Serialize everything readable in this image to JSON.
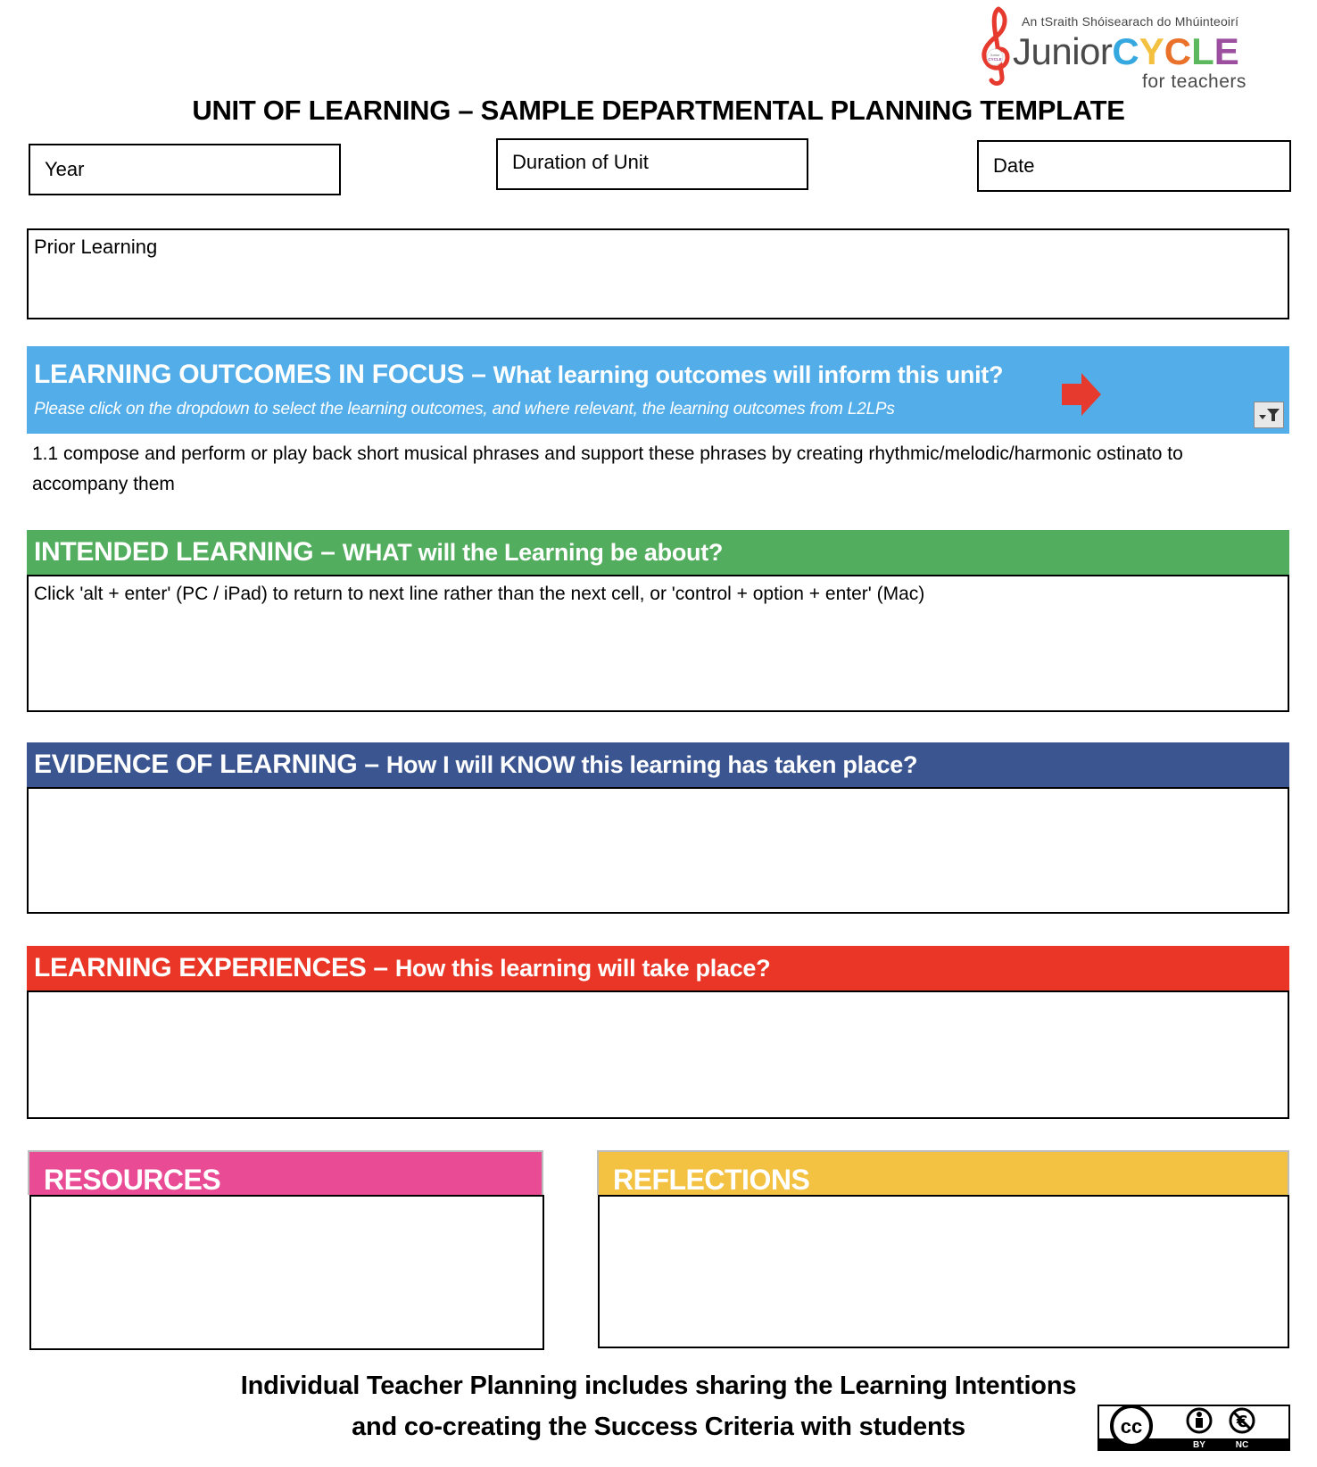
{
  "logo": {
    "tagline": "An tSraith Shóisearach do Mhúinteoirí",
    "junior": "Junior",
    "cycle_letters": [
      "C",
      "Y",
      "C",
      "L",
      "E"
    ],
    "cycle_colors": [
      "#35a8e0",
      "#f3c03f",
      "#e9712a",
      "#5cb85c",
      "#9b4f9e"
    ],
    "for_teachers": "for teachers",
    "clef_color": "#e63a2e"
  },
  "title": "UNIT OF LEARNING – SAMPLE DEPARTMENTAL PLANNING TEMPLATE",
  "fields": {
    "year_label": "Year",
    "duration_label": "Duration of Unit",
    "date_label": "Date"
  },
  "prior_learning": {
    "label": "Prior Learning"
  },
  "learning_outcomes": {
    "heading_main": "LEARNING OUTCOMES IN FOCUS – ",
    "heading_sub": "What learning outcomes will inform this unit?",
    "hint": "Please  click on the dropdown to select the learning outcomes, and where relevant, the learning outcomes from L2LPs",
    "selected_outcome": "1.1 compose and perform or play back short musical phrases and support these phrases by creating rhythmic/melodic/harmonic ostinato to accompany them",
    "color": "#52ade8",
    "arrow_color": "#e63a2e"
  },
  "intended_learning": {
    "heading_main": "INTENDED LEARNING – ",
    "heading_sub": "WHAT will the Learning be about?",
    "body": "Click 'alt + enter' (PC / iPad) to return to next line rather than the next cell, or 'control + option + enter' (Mac)",
    "color": "#52ad5e"
  },
  "evidence_of_learning": {
    "heading_main": "EVIDENCE OF LEARNING – ",
    "heading_sub": "How I will KNOW this learning has taken place?",
    "color": "#3b5591"
  },
  "learning_experiences": {
    "heading_main": "LEARNING EXPERIENCES – ",
    "heading_sub": "How this learning will take place?",
    "color": "#e93626"
  },
  "resources": {
    "heading": "RESOURCES",
    "color": "#e94b95"
  },
  "reflections": {
    "heading": "REFLECTIONS",
    "color": "#f4c242"
  },
  "footer": {
    "line1": "Individual Teacher Planning includes sharing the Learning Intentions",
    "line2": "and co-creating the Success Criteria with students"
  },
  "license": {
    "cc": "cc",
    "by": "BY",
    "nc": "NC"
  }
}
